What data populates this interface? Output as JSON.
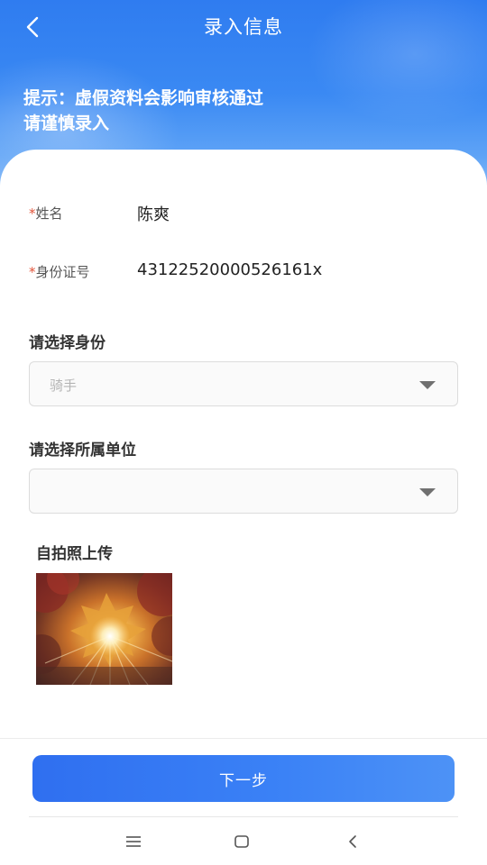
{
  "header": {
    "title": "录入信息",
    "notice_line1": "提示：虚假资料会影响审核通过",
    "notice_line2": "请谨慎录入"
  },
  "form": {
    "name": {
      "required_mark": "*",
      "label": "姓名",
      "value": "陈爽"
    },
    "id_number": {
      "required_mark": "*",
      "label": "身份证号",
      "value": "43122520000526161x"
    },
    "identity": {
      "label": "请选择身份",
      "selected": "骑手"
    },
    "unit": {
      "label": "请选择所属单位",
      "selected": ""
    },
    "photo": {
      "label": "自拍照上传"
    }
  },
  "actions": {
    "next_label": "下一步"
  },
  "system_nav": {
    "items": [
      "menu-icon",
      "home-icon",
      "back-icon"
    ]
  },
  "colors": {
    "header_blue": "#2f7cf0",
    "button_blue": "#3b82f6",
    "required_red": "#e2553b"
  }
}
